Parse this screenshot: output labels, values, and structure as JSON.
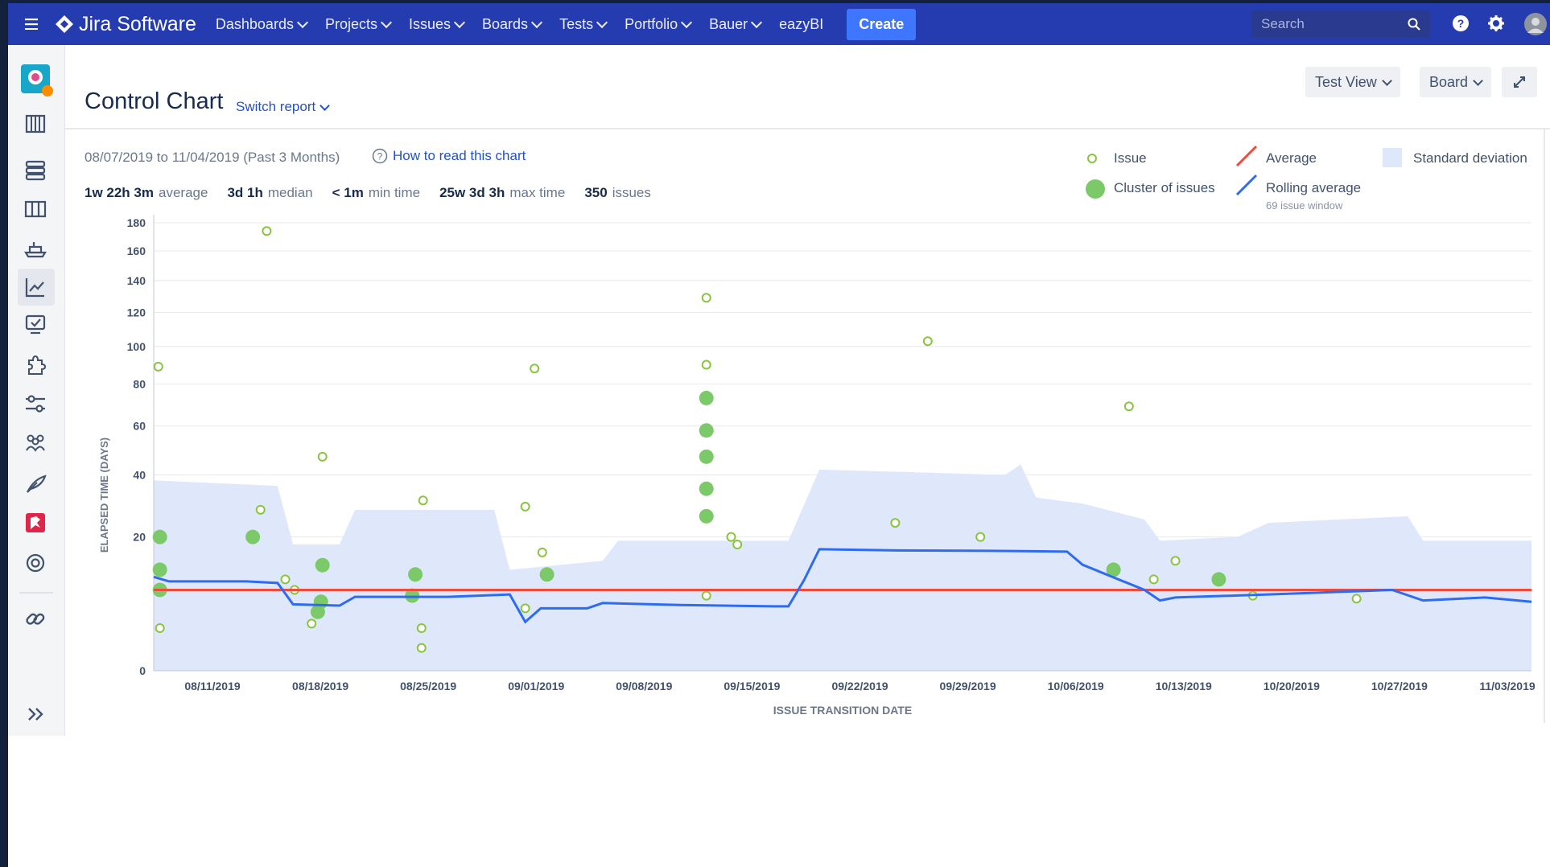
{
  "topnav": {
    "app_name": "Jira Software",
    "items": [
      {
        "label": "Dashboards"
      },
      {
        "label": "Projects"
      },
      {
        "label": "Issues"
      },
      {
        "label": "Boards"
      },
      {
        "label": "Tests"
      },
      {
        "label": "Portfolio"
      },
      {
        "label": "Bauer"
      }
    ],
    "ezybi": "eazyBI",
    "create": "Create",
    "search_placeholder": "Search"
  },
  "header": {
    "title": "Control Chart",
    "switch_report": "Switch report",
    "test_view": "Test View",
    "board": "Board"
  },
  "meta": {
    "date_range": "08/07/2019 to 11/04/2019 (Past 3 Months)",
    "how_to_read": "How to read this chart",
    "stats": [
      {
        "value": "1w 22h 3m",
        "label": "average"
      },
      {
        "value": "3d 1h",
        "label": "median"
      },
      {
        "value": "< 1m",
        "label": "min time"
      },
      {
        "value": "25w 3d 3h",
        "label": "max time"
      },
      {
        "value": "350",
        "label": "issues"
      }
    ]
  },
  "legend": {
    "issue": "Issue",
    "cluster": "Cluster of issues",
    "average": "Average",
    "rolling": "Rolling average",
    "rolling_sub": "69 issue window",
    "stddev": "Standard deviation"
  },
  "colors": {
    "nav": "#253bb0",
    "issue": "#7cc96a",
    "average": "#f04b3a",
    "rolling": "#2f6bef",
    "stddev": "#dfe8fb"
  },
  "chart_data": {
    "type": "scatter",
    "xlabel": "ISSUE TRANSITION DATE",
    "ylabel": "ELAPSED TIME (DAYS)",
    "y_scale": "compressed (sqrt-like)",
    "yticks": [
      0,
      20,
      40,
      60,
      80,
      100,
      120,
      140,
      160,
      180
    ],
    "xticks": [
      "08/11/2019",
      "08/18/2019",
      "08/25/2019",
      "09/01/2019",
      "09/08/2019",
      "09/15/2019",
      "09/22/2019",
      "09/29/2019",
      "10/06/2019",
      "10/13/2019",
      "10/20/2019",
      "10/27/2019",
      "11/03/2019"
    ],
    "x_range": [
      "2019-08-07",
      "2019-11-04"
    ],
    "average": 8,
    "rolling_average": [
      [
        "2019-08-07",
        10.5
      ],
      [
        "2019-08-08",
        9.6
      ],
      [
        "2019-08-13",
        9.6
      ],
      [
        "2019-08-15",
        9.3
      ],
      [
        "2019-08-16",
        5.6
      ],
      [
        "2019-08-19",
        5.4
      ],
      [
        "2019-08-20",
        6.8
      ],
      [
        "2019-08-26",
        6.8
      ],
      [
        "2019-08-30",
        7.2
      ],
      [
        "2019-08-31",
        3.2
      ],
      [
        "2019-09-01",
        5.0
      ],
      [
        "2019-09-04",
        5.0
      ],
      [
        "2019-09-05",
        5.8
      ],
      [
        "2019-09-10",
        5.5
      ],
      [
        "2019-09-16",
        5.3
      ],
      [
        "2019-09-17",
        5.3
      ],
      [
        "2019-09-18",
        9.8
      ],
      [
        "2019-09-19",
        16.8
      ],
      [
        "2019-09-24",
        16.5
      ],
      [
        "2019-09-30",
        16.4
      ],
      [
        "2019-10-05",
        16.2
      ],
      [
        "2019-10-06",
        13.1
      ],
      [
        "2019-10-10",
        8.0
      ],
      [
        "2019-10-11",
        6.2
      ],
      [
        "2019-10-12",
        6.7
      ],
      [
        "2019-10-18",
        7.2
      ],
      [
        "2019-10-26",
        8.0
      ],
      [
        "2019-10-28",
        6.2
      ],
      [
        "2019-11-01",
        6.7
      ],
      [
        "2019-11-04",
        6.0
      ]
    ],
    "std_band_upper": [
      [
        "2019-08-07",
        38
      ],
      [
        "2019-08-15",
        36
      ],
      [
        "2019-08-16",
        18
      ],
      [
        "2019-08-19",
        18
      ],
      [
        "2019-08-20",
        28
      ],
      [
        "2019-08-29",
        28
      ],
      [
        "2019-08-30",
        12
      ],
      [
        "2019-09-05",
        14
      ],
      [
        "2019-09-06",
        19
      ],
      [
        "2019-09-17",
        19
      ],
      [
        "2019-09-19",
        42
      ],
      [
        "2019-10-01",
        40
      ],
      [
        "2019-10-02",
        44
      ],
      [
        "2019-10-03",
        32
      ],
      [
        "2019-10-06",
        30
      ],
      [
        "2019-10-10",
        25
      ],
      [
        "2019-10-11",
        19
      ],
      [
        "2019-10-16",
        20
      ],
      [
        "2019-10-18",
        24
      ],
      [
        "2019-10-27",
        26
      ],
      [
        "2019-10-28",
        19
      ],
      [
        "2019-11-04",
        19
      ]
    ],
    "issues": [
      [
        0.3,
        89,
        "o"
      ],
      [
        0.4,
        20,
        "c"
      ],
      [
        0.4,
        12,
        "c"
      ],
      [
        0.4,
        8,
        "c"
      ],
      [
        0.4,
        2.5,
        "o"
      ],
      [
        7.3,
        174,
        "o"
      ],
      [
        6.9,
        28,
        "o"
      ],
      [
        6.4,
        20,
        "c"
      ],
      [
        8.5,
        10,
        "o"
      ],
      [
        9.1,
        8,
        "o"
      ],
      [
        10.9,
        47,
        "o"
      ],
      [
        10.9,
        13,
        "c"
      ],
      [
        10.8,
        6,
        "c"
      ],
      [
        10.6,
        4.5,
        "c"
      ],
      [
        10.2,
        3,
        "o"
      ],
      [
        17.4,
        31,
        "o"
      ],
      [
        17.3,
        2.5,
        "o"
      ],
      [
        17.3,
        0.8,
        "o"
      ],
      [
        16.9,
        11,
        "c"
      ],
      [
        16.7,
        7,
        "c"
      ],
      [
        24.6,
        88,
        "o"
      ],
      [
        24.0,
        29,
        "o"
      ],
      [
        24.0,
        5,
        "o"
      ],
      [
        25.1,
        16,
        "o"
      ],
      [
        25.4,
        11,
        "c"
      ],
      [
        35.7,
        129,
        "o"
      ],
      [
        35.7,
        90,
        "o"
      ],
      [
        35.7,
        73,
        "c"
      ],
      [
        35.7,
        58,
        "c"
      ],
      [
        35.7,
        47,
        "c"
      ],
      [
        35.7,
        35,
        "c"
      ],
      [
        35.7,
        26,
        "c"
      ],
      [
        35.7,
        7,
        "o"
      ],
      [
        37.3,
        20,
        "o"
      ],
      [
        37.7,
        18,
        "o"
      ],
      [
        50.0,
        103,
        "o"
      ],
      [
        47.9,
        24,
        "o"
      ],
      [
        53.4,
        20,
        "o"
      ],
      [
        63.0,
        69,
        "o"
      ],
      [
        64.6,
        10,
        "o"
      ],
      [
        62.0,
        12,
        "c"
      ],
      [
        66.0,
        14,
        "o"
      ],
      [
        68.8,
        10,
        "c"
      ],
      [
        71.0,
        7,
        "o"
      ],
      [
        77.7,
        6.5,
        "o"
      ]
    ]
  }
}
